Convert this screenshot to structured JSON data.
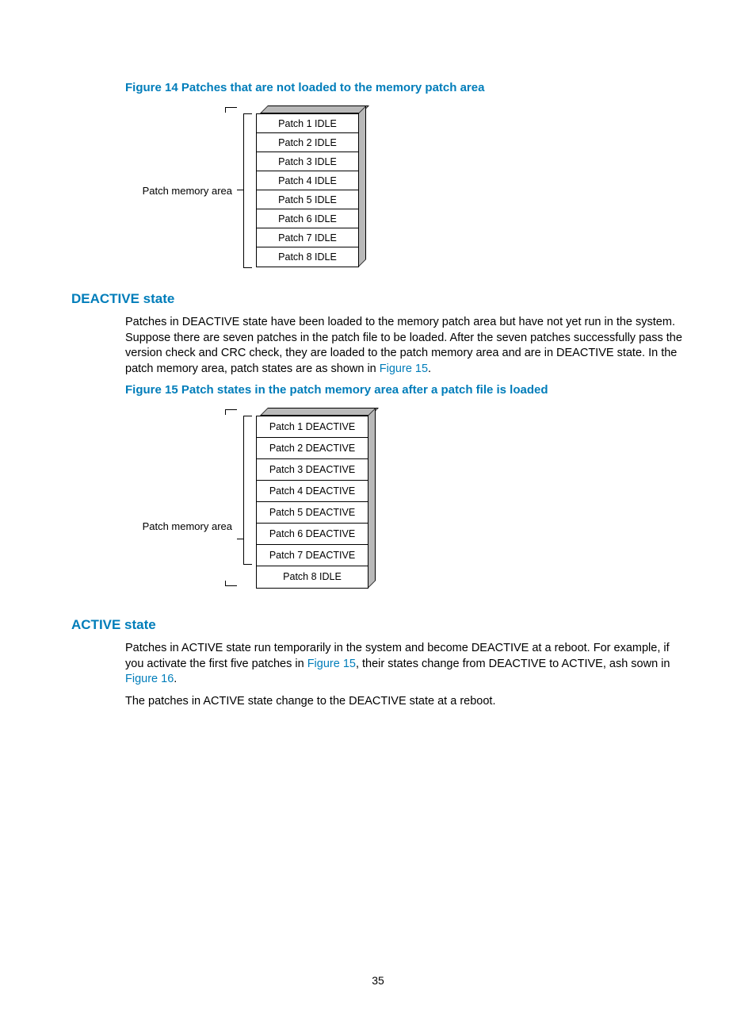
{
  "page_number": "35",
  "figure14": {
    "caption": "Figure 14 Patches that are not loaded to the memory patch area",
    "mem_label": "Patch memory area",
    "cells": [
      "Patch 1 IDLE",
      "Patch 2 IDLE",
      "Patch 3 IDLE",
      "Patch 4 IDLE",
      "Patch 5 IDLE",
      "Patch 6 IDLE",
      "Patch 7 IDLE",
      "Patch 8 IDLE"
    ]
  },
  "deactive": {
    "heading": "DEACTIVE state",
    "para_a": "Patches in DEACTIVE state have been loaded to the memory patch area but have not yet run in the system. Suppose there are seven patches in the patch file to be loaded. After the seven patches successfully pass the version check and CRC check, they are loaded to the patch memory area and are in DEACTIVE state. In the patch memory area, patch states are as shown in ",
    "para_a_link": "Figure 15",
    "para_a_after": "."
  },
  "figure15": {
    "caption": "Figure 15 Patch states in the patch memory area after a patch file is loaded",
    "mem_label": "Patch memory area",
    "cells": [
      "Patch 1 DEACTIVE",
      "Patch 2 DEACTIVE",
      "Patch 3 DEACTIVE",
      "Patch 4 DEACTIVE",
      "Patch 5 DEACTIVE",
      "Patch 6 DEACTIVE",
      "Patch 7 DEACTIVE",
      "Patch 8 IDLE"
    ]
  },
  "active": {
    "heading": "ACTIVE state",
    "para_a_before": "Patches in ACTIVE state run temporarily in the system and become DEACTIVE at a reboot. For example, if you activate the first five patches in ",
    "para_a_link1": "Figure 15",
    "para_a_mid": ", their states change from DEACTIVE to ACTIVE, ash sown in ",
    "para_a_link2": "Figure 16",
    "para_a_after": ".",
    "para_b": "The patches in ACTIVE state change to the DEACTIVE state at a reboot."
  }
}
